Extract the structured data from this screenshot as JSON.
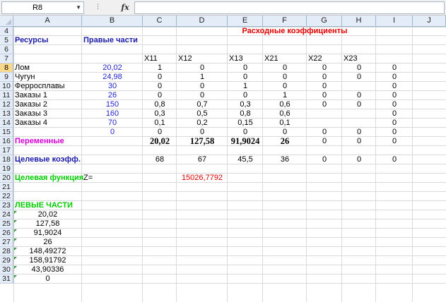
{
  "formula_bar": {
    "name_box": "R8",
    "fx": "fx",
    "dots": "⋮",
    "formula": ""
  },
  "columns": [
    "A",
    "B",
    "C",
    "D",
    "E",
    "F",
    "G",
    "H",
    "I",
    "J"
  ],
  "rows": [
    "4",
    "5",
    "6",
    "7",
    "8",
    "9",
    "10",
    "11",
    "12",
    "13",
    "14",
    "15",
    "16",
    "17",
    "18",
    "19",
    "20",
    "21",
    "22",
    "23",
    "24",
    "25",
    "26",
    "27",
    "28",
    "29",
    "30",
    "31"
  ],
  "selected_row": "8",
  "sheet": {
    "title_rashod": "Расходные коэффициенты",
    "resources_header": "Ресурсы",
    "rhs_header": "Правые  части",
    "var_headers": [
      "X11",
      "X12",
      "X13",
      "X21",
      "X22",
      "X23"
    ],
    "resource_rows": [
      {
        "label": "Лом",
        "rhs": "20,02",
        "coef": [
          "1",
          "0",
          "0",
          "0",
          "0",
          "0",
          "0"
        ]
      },
      {
        "label": "Чугун",
        "rhs": "24,98",
        "coef": [
          "0",
          "1",
          "0",
          "0",
          "0",
          "0",
          "0"
        ]
      },
      {
        "label": "Ферросплавы",
        "rhs": "30",
        "coef": [
          "0",
          "0",
          "1",
          "0",
          "0",
          "",
          "0"
        ]
      },
      {
        "label": "Заказы 1",
        "rhs": "26",
        "coef": [
          "0",
          "0",
          "0",
          "1",
          "0",
          "0",
          "0"
        ]
      },
      {
        "label": "Заказы 2",
        "rhs": "150",
        "coef": [
          "0,8",
          "0,7",
          "0,3",
          "0,6",
          "0",
          "0",
          "0"
        ]
      },
      {
        "label": "Заказы 3",
        "rhs": "160",
        "coef": [
          "0,3",
          "0,5",
          "0,8",
          "0,6",
          "",
          "",
          "0"
        ]
      },
      {
        "label": "Заказы 4",
        "rhs": "70",
        "coef": [
          "0,1",
          "0,2",
          "0,15",
          "0,1",
          "",
          "",
          "0"
        ]
      },
      {
        "label": "",
        "rhs": "0",
        "coef": [
          "0",
          "0",
          "0",
          "0",
          "0",
          "0",
          "0"
        ]
      }
    ],
    "variables_label": "Переменные",
    "variables_values": [
      "20,02",
      "127,58",
      "91,9024",
      "26",
      "0",
      "0",
      "0"
    ],
    "objective_coef_label": "Целевые коэфф.",
    "objective_coefs": [
      "68",
      "67",
      "45,5",
      "36",
      "0",
      "0",
      "0"
    ],
    "objective_label": "Целевая функция",
    "z_label": "Z=",
    "objective_value": "15026,7792",
    "lhs_label": "ЛЕВЫЕ ЧАСТИ",
    "lhs_values": [
      "20,02",
      "127,58",
      "91,9024",
      "26",
      "148,49272",
      "158,91792",
      "43,90336",
      "0"
    ]
  }
}
